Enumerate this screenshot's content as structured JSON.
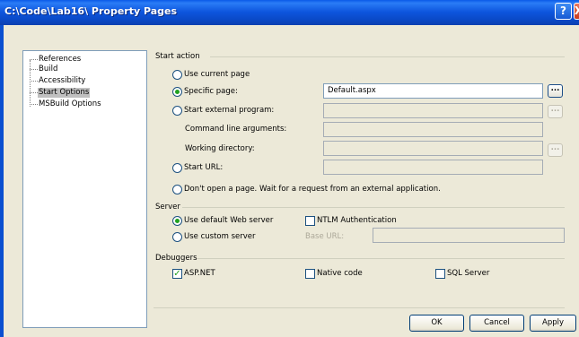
{
  "window": {
    "title": "C:\\Code\\Lab16\\ Property Pages"
  },
  "titlebar": {
    "help_label": "?",
    "close_label": "X"
  },
  "tree": {
    "items": [
      {
        "label": "References",
        "selected": false
      },
      {
        "label": "Build",
        "selected": false
      },
      {
        "label": "Accessibility",
        "selected": false
      },
      {
        "label": "Start Options",
        "selected": true
      },
      {
        "label": "MSBuild Options",
        "selected": false
      }
    ]
  },
  "start_action": {
    "title": "Start action",
    "use_current_page": "Use current page",
    "specific_page": "Specific page:",
    "specific_page_value": "Default.aspx",
    "start_external_program": "Start external program:",
    "command_line_arguments": "Command line arguments:",
    "working_directory": "Working directory:",
    "start_url": "Start URL:",
    "dont_open": "Don't open a page.  Wait for a request from an external application.",
    "browse_label": "..."
  },
  "server": {
    "title": "Server",
    "use_default_web_server": "Use default Web server",
    "ntlm_authentication": "NTLM Authentication",
    "use_custom_server": "Use custom server",
    "base_url": "Base URL:"
  },
  "debuggers": {
    "title": "Debuggers",
    "aspnet": "ASP.NET",
    "aspnet_checked": true,
    "native_code": "Native code",
    "sql_server": "SQL Server"
  },
  "buttons": {
    "ok": "OK",
    "cancel": "Cancel",
    "apply": "Apply"
  },
  "colors": {
    "title_bar": "#0a49c7",
    "dialog_bg": "#ece9d8",
    "radio_dot": "#21a121"
  }
}
